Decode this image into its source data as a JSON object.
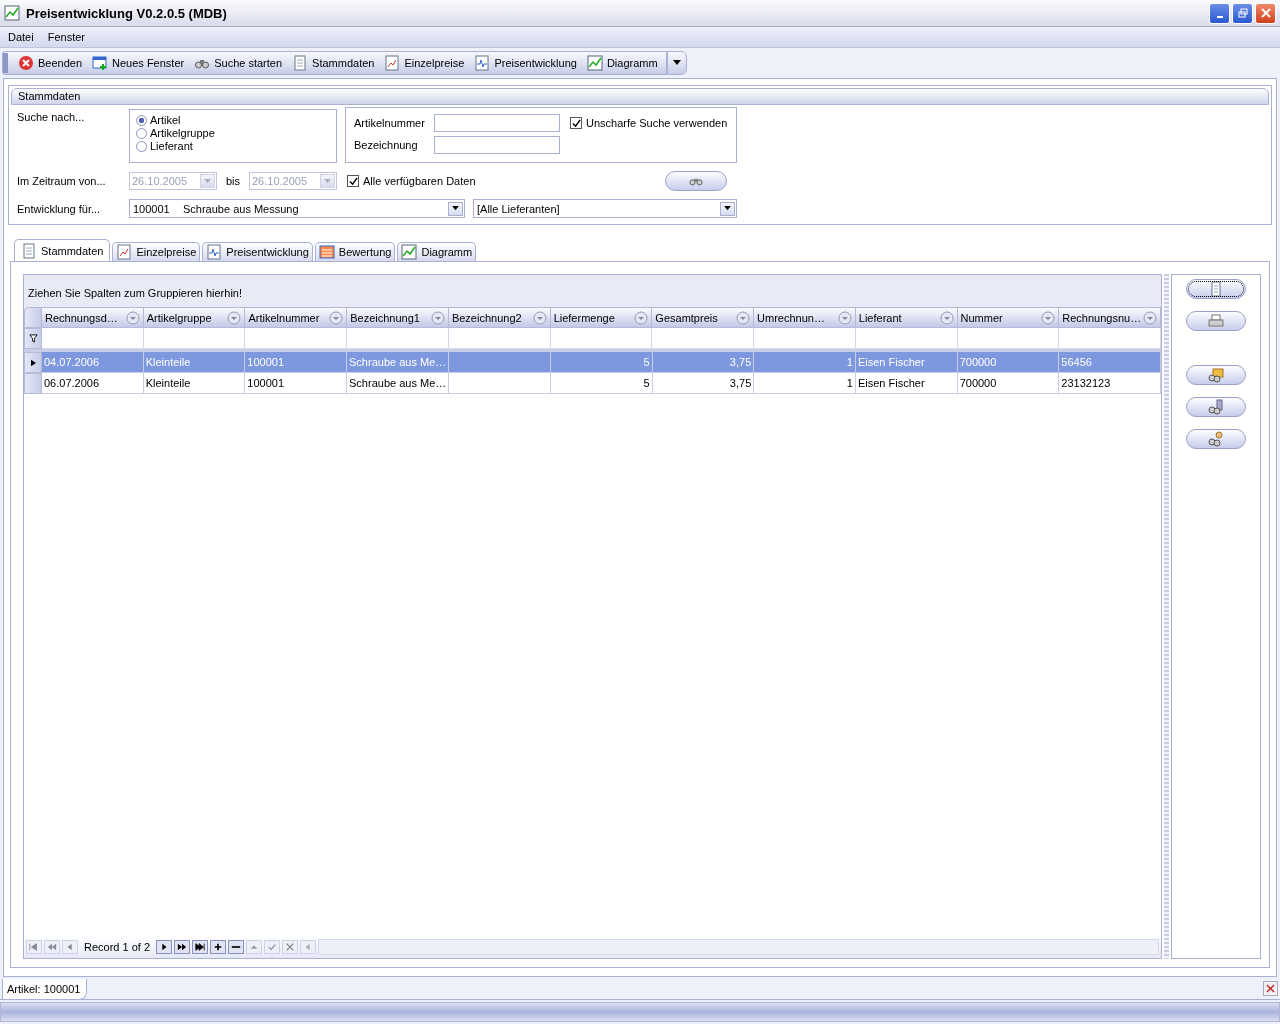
{
  "window": {
    "title": "Preisentwicklung V0.2.0.5 (MDB)"
  },
  "menu": [
    "Datei",
    "Fenster"
  ],
  "toolbar": [
    {
      "label": "Beenden",
      "kind": "close"
    },
    {
      "label": "Neues Fenster",
      "kind": "newwindow"
    },
    {
      "label": "Suche starten",
      "kind": "search"
    },
    {
      "label": "Stammdaten",
      "kind": "document"
    },
    {
      "label": "Einzelpreise",
      "kind": "prices"
    },
    {
      "label": "Preisentwicklung",
      "kind": "development"
    },
    {
      "label": "Diagramm",
      "kind": "chart"
    }
  ],
  "stammdaten": {
    "title": "Stammdaten",
    "search_label": "Suche nach...",
    "search_options": [
      {
        "label": "Artikel",
        "selected": true
      },
      {
        "label": "Artikelgruppe",
        "selected": false
      },
      {
        "label": "Lieferant",
        "selected": false
      }
    ],
    "fields": [
      {
        "label": "Artikelnummer"
      },
      {
        "label": "Bezeichnung"
      }
    ],
    "fuzzy": {
      "label": "Unscharfe Suche verwenden",
      "checked": true
    },
    "period_label": "Im Zeitraum von...",
    "date_from": "26.10.2005",
    "until_label": "bis",
    "date_to": "26.10.2005",
    "all_data": {
      "label": "Alle verfügbaren Daten",
      "checked": true
    },
    "development_label": "Entwicklung für...",
    "article_number": "100001",
    "article_name": "Schraube aus Messung",
    "supplier": "[Alle Lieferanten]"
  },
  "tabs": [
    {
      "label": "Stammdaten",
      "kind": "document",
      "selected": true
    },
    {
      "label": "Einzelpreise",
      "kind": "prices",
      "selected": false
    },
    {
      "label": "Preisentwicklung",
      "kind": "development",
      "selected": false
    },
    {
      "label": "Bewertung",
      "kind": "rating",
      "selected": false
    },
    {
      "label": "Diagramm",
      "kind": "chart",
      "selected": false
    }
  ],
  "grid": {
    "group_hint": "Ziehen Sie Spalten zum Gruppieren hierhin!",
    "columns": [
      {
        "label": "Rechnungsd…",
        "kind": "text"
      },
      {
        "label": "Artikelgruppe",
        "kind": "text"
      },
      {
        "label": "Artikelnummer",
        "kind": "text"
      },
      {
        "label": "Bezeichnung1",
        "kind": "text"
      },
      {
        "label": "Bezeichnung2",
        "kind": "text"
      },
      {
        "label": "Liefermenge",
        "kind": "number"
      },
      {
        "label": "Gesamtpreis",
        "kind": "number"
      },
      {
        "label": "Umrechnun…",
        "kind": "number"
      },
      {
        "label": "Lieferant",
        "kind": "text"
      },
      {
        "label": "Nummer",
        "kind": "text"
      },
      {
        "label": "Rechnungsnu…",
        "kind": "text"
      }
    ],
    "rows": [
      {
        "selected": true,
        "cells": [
          "04.07.2006",
          "Kleinteile",
          "100001",
          "Schraube aus Me…",
          "",
          "5",
          "3,75",
          "1",
          "Eisen Fischer",
          "700000",
          "56456"
        ]
      },
      {
        "selected": false,
        "cells": [
          "06.07.2006",
          "Kleinteile",
          "100001",
          "Schraube aus Me…",
          "",
          "5",
          "3,75",
          "1",
          "Eisen Fischer",
          "700000",
          "23132123"
        ]
      }
    ],
    "record_text": "Record 1 of 2"
  },
  "side_buttons": [
    {
      "kind": "document"
    },
    {
      "kind": "print"
    },
    {
      "kind": "search-folder"
    },
    {
      "kind": "search-database"
    },
    {
      "kind": "search-person"
    }
  ],
  "status_tab": "Artikel: 100001"
}
